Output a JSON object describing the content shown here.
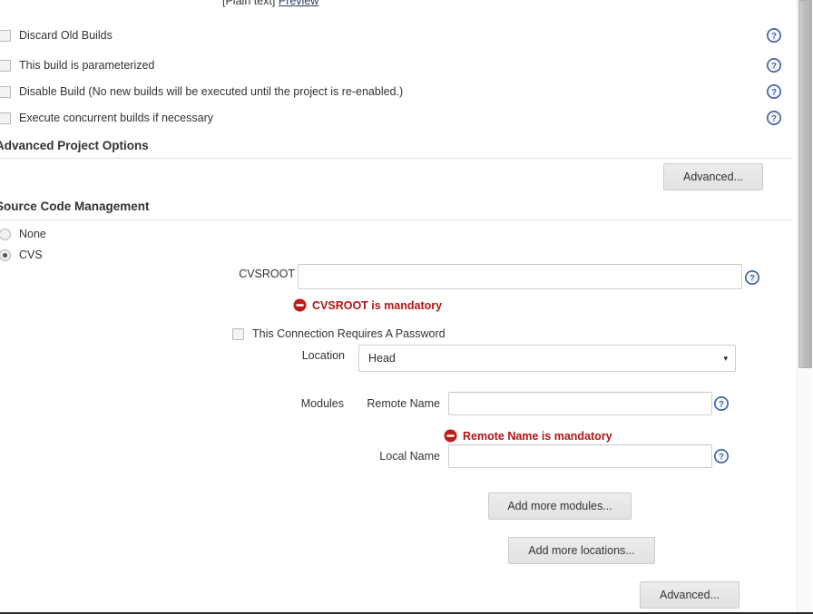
{
  "preview": {
    "plain_text_label": "[Plain text]",
    "preview_link": "Preview"
  },
  "build_options": {
    "checkboxes": [
      {
        "label": "Discard Old Builds",
        "checked": false
      },
      {
        "label": "This build is parameterized",
        "checked": false
      },
      {
        "label": "Disable Build (No new builds will be executed until the project is re-enabled.)",
        "checked": false
      },
      {
        "label": "Execute concurrent builds if necessary",
        "checked": false
      }
    ]
  },
  "sections": {
    "advanced_project_options": {
      "heading": "Advanced Project Options",
      "advanced_button": "Advanced..."
    },
    "source_code_management": {
      "heading": "Source Code Management",
      "radios": [
        {
          "label": "None",
          "selected": false
        },
        {
          "label": "CVS",
          "selected": true
        }
      ],
      "cvs": {
        "cvsroot_label": "CVSROOT",
        "cvsroot_value": "",
        "cvsroot_error": "CVSROOT is mandatory",
        "password_checkbox_label": "This Connection Requires A Password",
        "password_checkbox_checked": false,
        "location_label": "Location",
        "location_value": "Head",
        "location_options": [
          "Head"
        ],
        "modules_label": "Modules",
        "remote_name_label": "Remote Name",
        "remote_name_value": "",
        "remote_name_error": "Remote Name is mandatory",
        "local_name_label": "Local Name",
        "local_name_value": "",
        "add_more_modules_button": "Add more modules...",
        "add_more_locations_button": "Add more locations...",
        "advanced_button": "Advanced..."
      }
    }
  },
  "icons": {
    "help": "help-icon",
    "error": "error-icon",
    "dropdown_caret": "▾"
  },
  "colors": {
    "error_text": "#b31414",
    "error_icon": "#c11a1a",
    "help_icon": "#3b5d9e",
    "link": "#2b3a63",
    "button_bg": "#e6e6e6",
    "divider": "#e3e3e3"
  },
  "scroll": {
    "vertical_thumb_top": 0,
    "vertical_thumb_height": 406
  }
}
